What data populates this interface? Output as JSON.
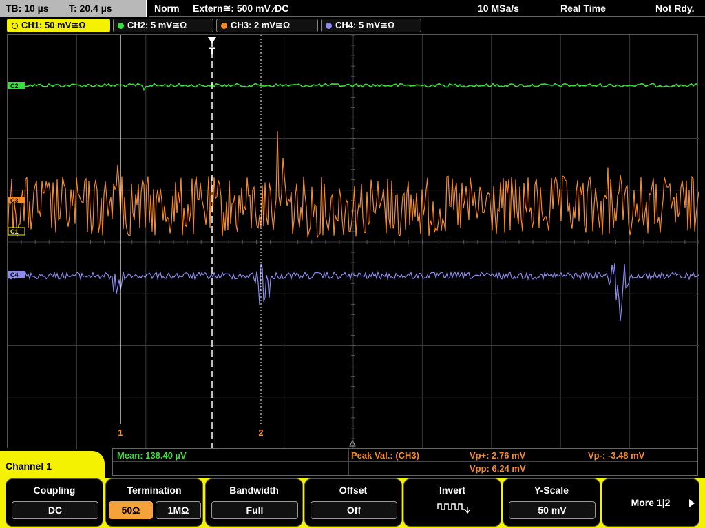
{
  "status": {
    "tb": "TB: 10 µs",
    "t": "T: 20.4 µs",
    "mode": "Norm",
    "trigger": "Extern≅: 500 mV ⁄DC",
    "rate": "10 MSa/s",
    "acq": "Real Time",
    "ready": "Not Rdy."
  },
  "tabs": [
    {
      "label": "CH1: 50 mV≅Ω",
      "color": "#f5f200"
    },
    {
      "label": "CH2: 5 mV≅Ω",
      "color": "#3cdc3c"
    },
    {
      "label": "CH3: 2 mV≅Ω",
      "color": "#f58a2a"
    },
    {
      "label": "CH4: 5 mV≅Ω",
      "color": "#8c8cf0"
    }
  ],
  "markers": {
    "trigger": "T",
    "cursor1": "1",
    "cursor2": "2",
    "ch2_tag": "C2",
    "ch3_tag": "C3",
    "ch1_tag": "C1",
    "ch4_tag": "C4"
  },
  "measurements": {
    "mean": "Mean: 138.40 µV",
    "peak_label": "Peak Val.: (CH3)",
    "vp_plus": "Vp+: 2.76 mV",
    "vp_minus": "Vp-: -3.48 mV",
    "vpp": "Vpp: 6.24 mV"
  },
  "channel_label": "Channel 1",
  "softkeys": {
    "coupling": {
      "title": "Coupling",
      "value": "DC"
    },
    "termination": {
      "title": "Termination",
      "opt1": "50Ω",
      "opt2": "1MΩ"
    },
    "bandwidth": {
      "title": "Bandwidth",
      "value": "Full"
    },
    "offset": {
      "title": "Offset",
      "value": "Off"
    },
    "invert": {
      "title": "Invert"
    },
    "yscale": {
      "title": "Y-Scale",
      "value": "50 mV"
    },
    "more": {
      "label": "More 1|2"
    }
  },
  "colors": {
    "ch1": "#f5f200",
    "ch2": "#3cdc3c",
    "ch3": "#f58a2a",
    "ch4": "#8c8cf0"
  }
}
